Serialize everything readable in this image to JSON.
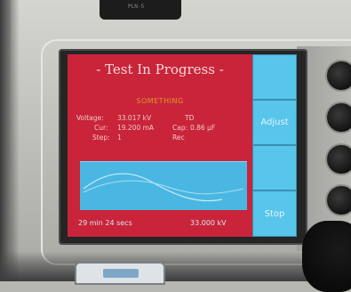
{
  "device": {
    "top_label": "PLN-5",
    "screen": {
      "title": "- Test In Progress -",
      "status": "SOMETHING",
      "readouts": {
        "voltage_label": "Voltage:",
        "voltage_value": "33.017 kV",
        "td_label": "TD",
        "cur_label": "Cur:",
        "cur_value": "19.200 mA",
        "cap_label": "Cap:",
        "cap_value": "0.86 µF",
        "step_label": "Step:",
        "step_value": "1",
        "rec_label": "Rec"
      },
      "timer": "29 min 24 secs",
      "output_kv": "33.000 kV"
    },
    "softkeys": [
      {
        "label": ""
      },
      {
        "label": "Adjust"
      },
      {
        "label": ""
      },
      {
        "label": "Stop"
      }
    ]
  },
  "colors": {
    "screen_bg": "#c9243a",
    "softkey": "#58c5ea",
    "status_text": "#d79a2a",
    "wave_panel": "#4ab7e2"
  }
}
